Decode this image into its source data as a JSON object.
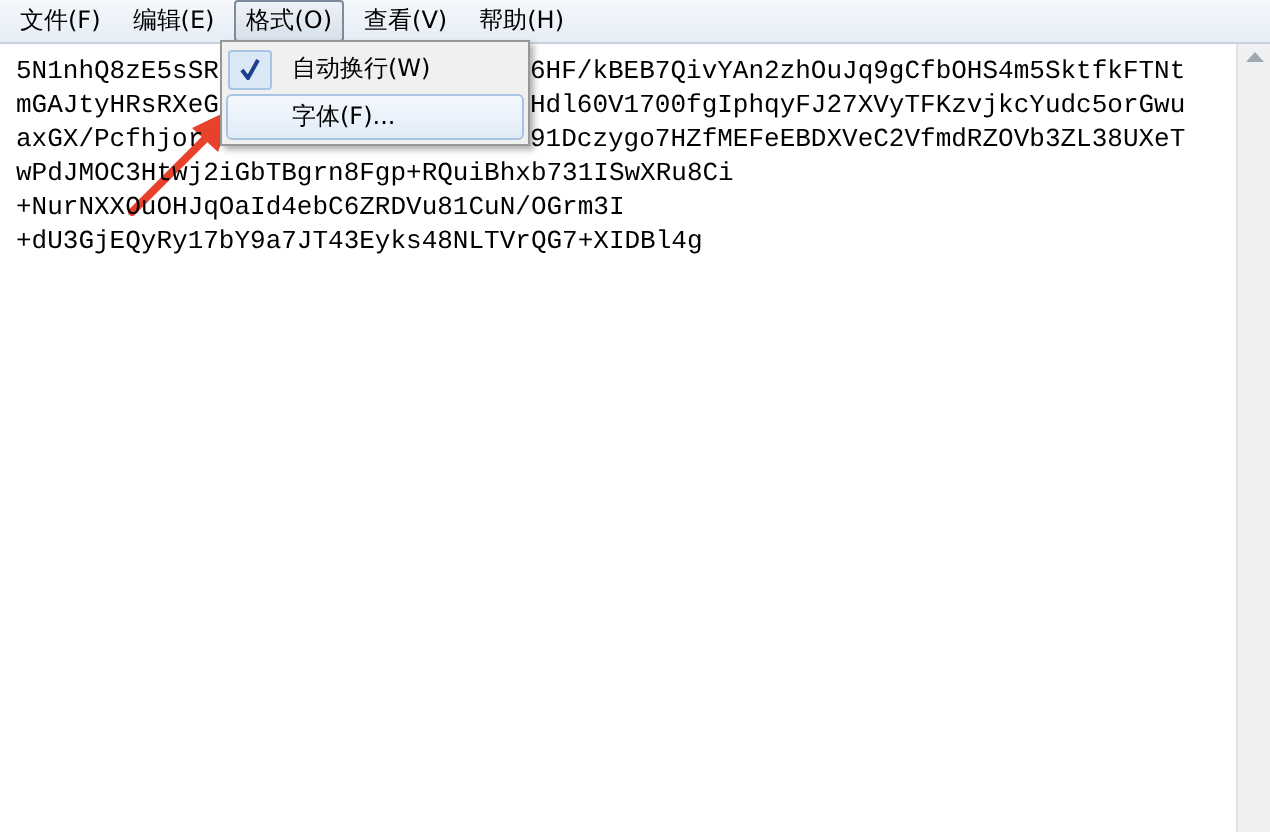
{
  "menu_bar": [
    {
      "label": "文件(F)",
      "selected": false
    },
    {
      "label": "编辑(E)",
      "selected": false
    },
    {
      "label": "格式(O)",
      "selected": true
    },
    {
      "label": "查看(V)",
      "selected": false
    },
    {
      "label": "帮助(H)",
      "selected": false
    }
  ],
  "dropdown": [
    {
      "label": "自动换行(W)",
      "checked": true,
      "selected": false
    },
    {
      "label": "字体(F)...",
      "checked": false,
      "selected": true
    }
  ],
  "text_lines": [
    {
      "left": "5N1nhQ8zE5sSR",
      "right": "6HF/kBEB7QivYAn2zhOuJq9gCfbOHS4m5SktfkFTNt"
    },
    {
      "left": "mGAJtyHRsRXeG",
      "right": "Hdl60V1700fgIphqyFJ27XVyTFKzvjkcYudc5orGwu"
    },
    {
      "left": "axGX/Pcfhjor",
      "right": "91Dczygo7HZfMEFeEBDXVeC2VfmdRZOVb3ZL38UXeT"
    },
    {
      "left": "wPdJMOC3Htwj2iGbTBgrn8Fgp+RQuiBhxb731ISwXRu8Ci"
    },
    {
      "left": "+NurNXXOuOHJqOaId4ebC6ZRDVu81CuN/OGrm3I"
    },
    {
      "left": "+dU3GjEQyRy17bY9a7JT43Eyks48NLTVrQG7+XIDBl4g"
    }
  ]
}
